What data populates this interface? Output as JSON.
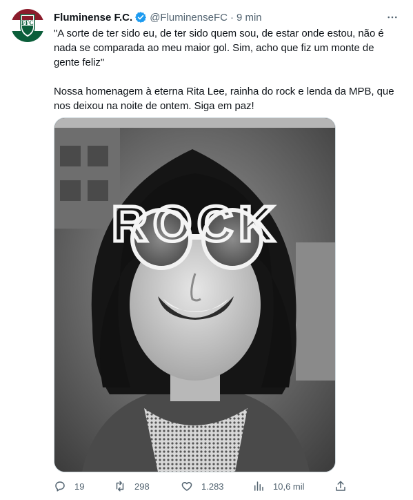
{
  "tweet": {
    "author_name": "Fluminense F.C.",
    "handle": "@FluminenseFC",
    "separator": "·",
    "time": "9 min",
    "text": "\"A sorte de ter sido eu, de ter sido quem sou, de estar onde estou, não é nada se comparada ao meu maior gol. Sim, acho que fiz um monte de gente feliz\"\n\nNossa homenagem à eterna Rita Lee, rainha do rock e lenda da MPB, que nos deixou na noite de ontem. Siga em paz!",
    "avatar_logo": "Fluminense crest (FFC)",
    "media_sign_text": "ROCK",
    "actions": {
      "replies": "19",
      "retweets": "298",
      "likes": "1.283",
      "views": "10,6 mil"
    }
  },
  "colors": {
    "verified_blue": "#1d9bf0",
    "muted_text": "#536471",
    "primary_text": "#0f1419",
    "crest_green": "#0b5e3a",
    "crest_maroon": "#8b1c2c"
  },
  "icons": {
    "verified": "verified-badge-icon",
    "more": "more-horizontal-icon",
    "reply": "reply-icon",
    "retweet": "retweet-icon",
    "like": "heart-icon",
    "views": "views-bar-chart-icon",
    "share": "share-icon"
  }
}
